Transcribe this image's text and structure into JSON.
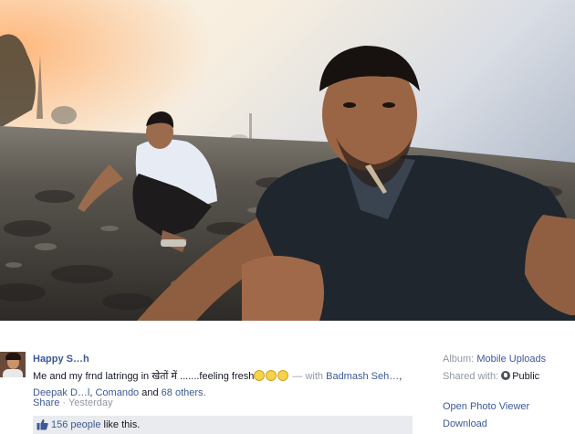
{
  "post": {
    "author": "Happy S…h",
    "status_text": "Me and my frnd latringg in खेतों में .......feeling fresh",
    "emoji_icons": [
      "grinning-face-icon",
      "grinning-face-icon",
      "grinning-face-icon"
    ],
    "with_prefix": "— with",
    "tagged_first": "Badmash Seh…",
    "tagged_second": "Deepak D…l",
    "tagged_third": "Comando",
    "and_word": "and",
    "others_link": "68 others.",
    "share_label": "Share",
    "meta_separator": "·",
    "timestamp": "Yesterday",
    "like_count": "156 people",
    "like_suffix": "like this."
  },
  "sidebar": {
    "album_label": "Album:",
    "album_value": "Mobile Uploads",
    "shared_label": "Shared with:",
    "shared_icon": "globe-icon",
    "shared_value": "Public",
    "open_viewer": "Open Photo Viewer",
    "download": "Download"
  },
  "colors": {
    "link": "#3b5998",
    "muted": "#9197a3",
    "like_bar": "#e9ebee"
  }
}
